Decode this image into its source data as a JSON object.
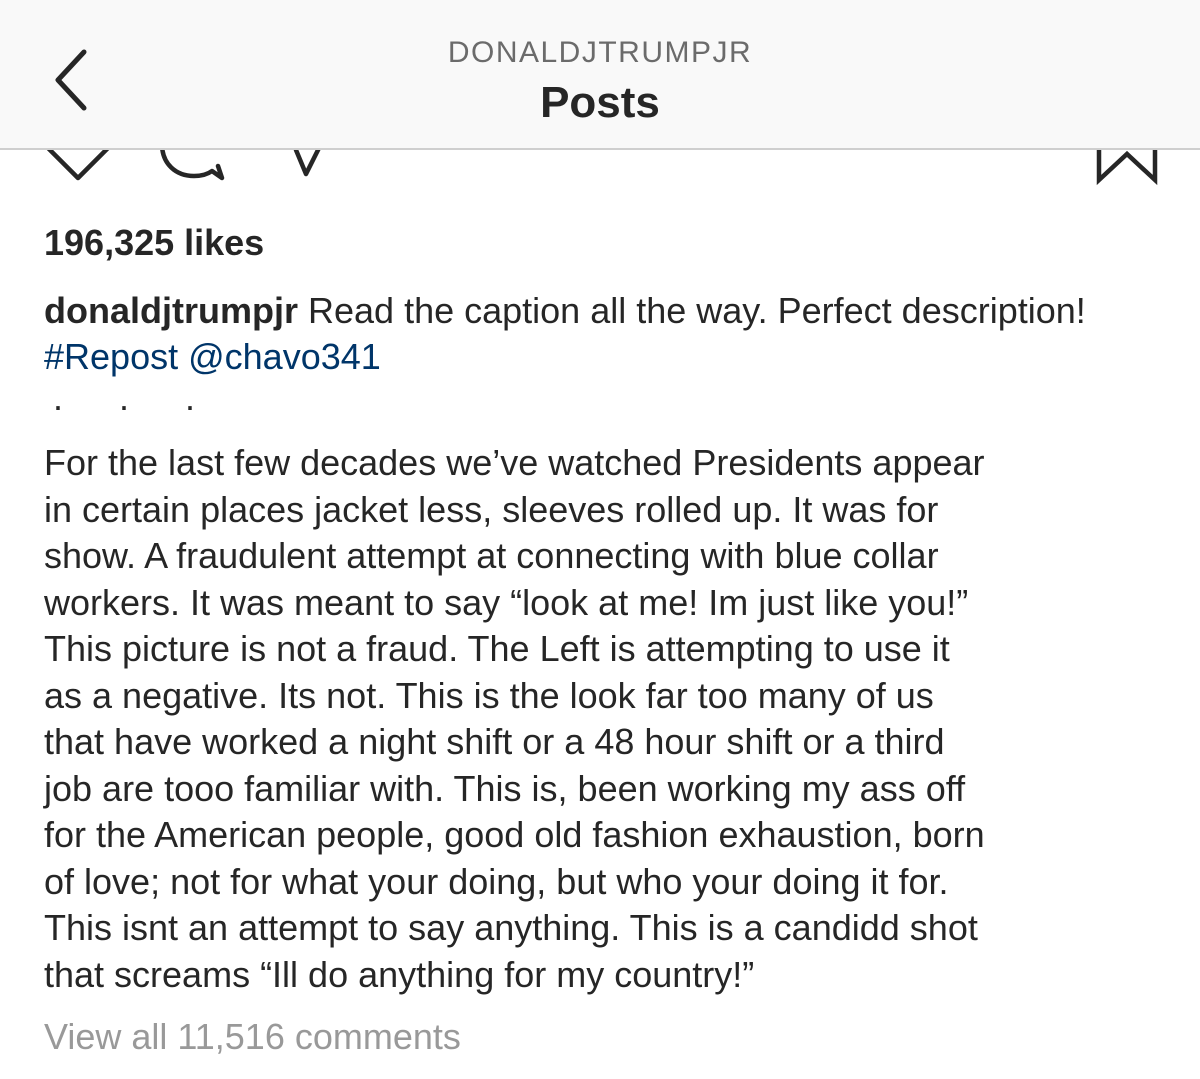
{
  "header": {
    "username": "DONALDJTRUMPJR",
    "title": "Posts"
  },
  "icons": {
    "back": "chevron-left-icon",
    "like": "heart-icon",
    "comment": "comment-icon",
    "share": "share-icon",
    "save": "bookmark-icon"
  },
  "post": {
    "likes": "196,325 likes",
    "caption": {
      "username": "donaldjtrumpjr",
      "text": " Read the caption all the way. Perfect description! ",
      "hashtag": "#Repost",
      "mention": "@chavo341"
    },
    "dots": "· · ·",
    "body_lines": [
      "For the last few decades we’ve watched Presidents appear",
      "in certain places jacket less, sleeves rolled up.  It was for",
      "show.  A fraudulent attempt at connecting with blue collar",
      "workers.  It was meant to say “look at me!  Im just like you!”",
      "This picture is not a fraud.  The Left is attempting to use it",
      "as a negative.  Its not.  This is the look far too many of us",
      "that have worked a night shift or a 48 hour shift or a third",
      "job are tooo familiar with.  This is, been working my ass off",
      "for the American people, good old fashion exhaustion, born",
      "of love; not for what your doing, but who your doing it for.",
      "This isnt an attempt to say anything.  This is a candidd shot",
      "that screams “Ill do anything for my country!”"
    ],
    "view_comments": "View all 11,516 comments"
  }
}
